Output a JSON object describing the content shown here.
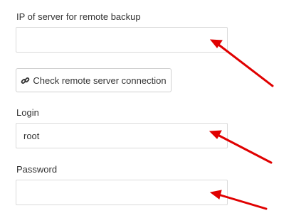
{
  "form": {
    "server_ip": {
      "label": "IP of server for remote backup",
      "value": "",
      "placeholder": ""
    },
    "check_button": {
      "label": "Check remote server connection",
      "icon": "link-icon"
    },
    "login": {
      "label": "Login",
      "value": "root",
      "placeholder": ""
    },
    "password": {
      "label": "Password",
      "value": "",
      "placeholder": ""
    }
  },
  "annotations": {
    "arrow_color": "#e00000",
    "count": 3
  }
}
